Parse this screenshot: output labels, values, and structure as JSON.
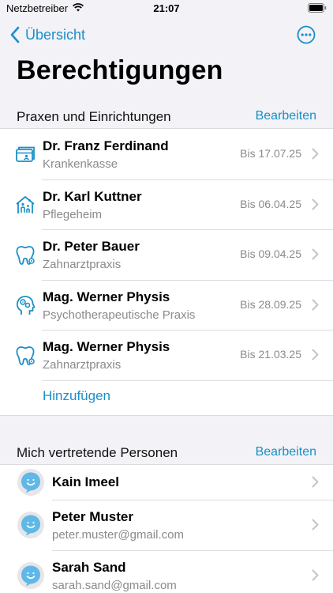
{
  "status_bar": {
    "carrier": "Netzbetreiber",
    "time": "21:07"
  },
  "nav": {
    "back_label": "Übersicht"
  },
  "page_title": "Berechtigungen",
  "practices": {
    "title": "Praxen und Einrichtungen",
    "action": "Bearbeiten",
    "items": [
      {
        "name": "Dr. Franz Ferdinand",
        "type": "Krankenkasse",
        "until": "Bis 17.07.25",
        "icon": "insurance-card-icon"
      },
      {
        "name": "Dr. Karl Kuttner",
        "type": "Pflegeheim",
        "until": "Bis 06.04.25",
        "icon": "care-home-icon"
      },
      {
        "name": "Dr. Peter Bauer",
        "type": "Zahnarztpraxis",
        "until": "Bis 09.04.25",
        "icon": "tooth-icon"
      },
      {
        "name": "Mag. Werner Physis",
        "type": "Psychotherapeutische Praxis",
        "until": "Bis 28.09.25",
        "icon": "head-gears-icon"
      },
      {
        "name": "Mag. Werner Physis",
        "type": "Zahnarztpraxis",
        "until": "Bis 21.03.25",
        "icon": "tooth-icon"
      }
    ],
    "add_label": "Hinzufügen"
  },
  "representatives": {
    "title": "Mich vertretende Personen",
    "action": "Bearbeiten",
    "items": [
      {
        "name": "Kain Imeel",
        "email": ""
      },
      {
        "name": "Peter Muster",
        "email": "peter.muster@gmail.com"
      },
      {
        "name": "Sarah Sand",
        "email": "sarah.sand@gmail.com"
      }
    ]
  },
  "colors": {
    "accent": "#1b8fc8",
    "background": "#f2f2f7",
    "secondary_text": "#8a8a8e"
  }
}
